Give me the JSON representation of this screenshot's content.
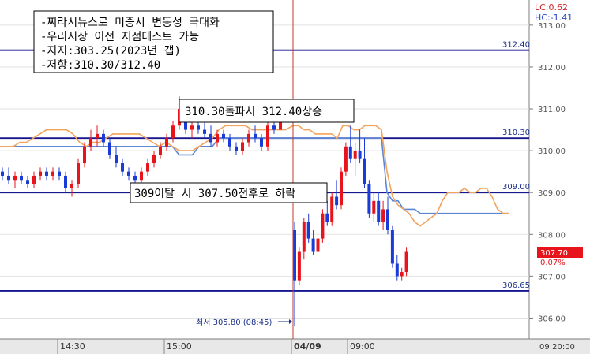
{
  "indicators": {
    "lc": "LC:0.62",
    "hc": "HC:-1.41"
  },
  "notes": [
    "-찌라시뉴스로 미증시 변동성 극대화",
    "-우리시장 이전 저점테스트 가능",
    "-지지:303.25(2023년 갭)",
    "-저항:310.30/312.40"
  ],
  "callouts": {
    "breakout": "310.30돌파시 312.40상승",
    "breakdown": "309이탈 시 307.50전후로 하락"
  },
  "low_label": "최저 305.80 (08:45)",
  "price_tag": {
    "value": "307.70",
    "change": "0.07%"
  },
  "colors": {
    "candle_up": "#e8141b",
    "candle_down": "#1a3bd6",
    "orange_line": "#f2a35c",
    "blue_line": "#5b86d6",
    "hline": "#16168f",
    "session_line": "#c0392b"
  },
  "chart_data": {
    "type": "candlestick",
    "x_labels": [
      "14:30",
      "15:00",
      "04/09",
      "09:00"
    ],
    "time_label": "09:20:00",
    "y_ticks": [
      306.0,
      307.0,
      308.0,
      309.0,
      310.0,
      311.0,
      312.0,
      313.0
    ],
    "y_range": [
      305.5,
      313.6
    ],
    "grid": true,
    "levels": [
      312.4,
      310.3,
      309.0,
      306.65
    ],
    "level_labels": [
      "312.40",
      "310.30",
      "309.00",
      "306.65"
    ],
    "low": 305.8,
    "last": 307.7,
    "candles": [
      [
        309.5,
        309.6,
        309.3,
        309.4
      ],
      [
        309.4,
        309.6,
        309.2,
        309.3
      ],
      [
        309.3,
        309.5,
        309.1,
        309.4
      ],
      [
        309.4,
        309.5,
        309.2,
        309.3
      ],
      [
        309.3,
        309.4,
        309.1,
        309.2
      ],
      [
        309.2,
        309.5,
        309.1,
        309.4
      ],
      [
        309.4,
        309.6,
        309.3,
        309.5
      ],
      [
        309.5,
        309.6,
        309.3,
        309.4
      ],
      [
        309.4,
        309.6,
        309.3,
        309.5
      ],
      [
        309.5,
        309.6,
        309.3,
        309.4
      ],
      [
        309.4,
        309.5,
        309.0,
        309.1
      ],
      [
        309.1,
        309.3,
        308.9,
        309.2
      ],
      [
        309.2,
        309.8,
        309.1,
        309.7
      ],
      [
        309.7,
        310.2,
        309.6,
        310.1
      ],
      [
        310.1,
        310.5,
        310.0,
        310.3
      ],
      [
        310.3,
        310.6,
        310.1,
        310.4
      ],
      [
        310.4,
        310.5,
        310.1,
        310.2
      ],
      [
        310.2,
        310.3,
        309.8,
        309.9
      ],
      [
        309.9,
        310.1,
        309.6,
        309.7
      ],
      [
        309.7,
        309.8,
        309.4,
        309.5
      ],
      [
        309.5,
        309.6,
        309.3,
        309.4
      ],
      [
        309.4,
        309.5,
        309.2,
        309.3
      ],
      [
        309.3,
        309.6,
        309.2,
        309.5
      ],
      [
        309.5,
        309.8,
        309.4,
        309.7
      ],
      [
        309.7,
        310.0,
        309.6,
        309.9
      ],
      [
        309.9,
        310.2,
        309.8,
        310.1
      ],
      [
        310.1,
        310.4,
        310.0,
        310.3
      ],
      [
        310.3,
        310.7,
        310.2,
        310.6
      ],
      [
        310.6,
        311.3,
        310.5,
        311.0
      ],
      [
        311.0,
        311.1,
        310.4,
        310.5
      ],
      [
        310.5,
        310.7,
        310.3,
        310.6
      ],
      [
        310.6,
        310.8,
        310.4,
        310.5
      ],
      [
        310.5,
        310.7,
        310.3,
        310.4
      ],
      [
        310.4,
        310.6,
        310.1,
        310.2
      ],
      [
        310.2,
        310.5,
        310.1,
        310.4
      ],
      [
        310.4,
        310.5,
        310.2,
        310.3
      ],
      [
        310.3,
        310.4,
        310.0,
        310.1
      ],
      [
        310.1,
        310.2,
        309.9,
        310.0
      ],
      [
        310.0,
        310.3,
        309.9,
        310.2
      ],
      [
        310.2,
        310.5,
        310.1,
        310.4
      ],
      [
        310.4,
        310.6,
        310.2,
        310.3
      ],
      [
        310.3,
        310.4,
        310.0,
        310.1
      ],
      [
        310.1,
        310.7,
        310.0,
        310.6
      ],
      [
        310.6,
        310.9,
        310.4,
        310.5
      ],
      [
        310.5,
        311.1,
        310.5,
        311.0
      ],
      [
        308.1,
        308.3,
        305.8,
        306.9
      ],
      [
        306.9,
        307.7,
        306.8,
        307.6
      ],
      [
        307.6,
        308.4,
        307.4,
        308.3
      ],
      [
        308.3,
        308.5,
        307.8,
        307.9
      ],
      [
        307.9,
        308.1,
        307.5,
        307.6
      ],
      [
        307.6,
        308.0,
        307.4,
        307.9
      ],
      [
        307.9,
        308.6,
        307.8,
        308.5
      ],
      [
        308.5,
        308.8,
        308.2,
        308.3
      ],
      [
        308.3,
        309.0,
        308.2,
        308.9
      ],
      [
        308.9,
        309.3,
        308.6,
        308.7
      ],
      [
        308.7,
        309.6,
        308.6,
        309.5
      ],
      [
        309.5,
        310.2,
        309.4,
        310.1
      ],
      [
        310.1,
        310.6,
        309.7,
        309.8
      ],
      [
        309.8,
        310.2,
        309.4,
        310.0
      ],
      [
        310.0,
        310.5,
        309.7,
        309.8
      ],
      [
        309.8,
        310.3,
        309.1,
        309.2
      ],
      [
        309.2,
        309.3,
        308.4,
        308.5
      ],
      [
        308.5,
        309.0,
        308.3,
        308.8
      ],
      [
        308.8,
        309.0,
        308.2,
        308.3
      ],
      [
        308.3,
        308.8,
        308.1,
        308.6
      ],
      [
        308.6,
        308.9,
        308.0,
        308.1
      ],
      [
        308.1,
        308.2,
        307.2,
        307.3
      ],
      [
        307.3,
        307.5,
        306.9,
        307.0
      ],
      [
        307.0,
        307.2,
        306.9,
        307.1
      ],
      [
        307.1,
        307.7,
        307.0,
        307.6
      ]
    ],
    "orange_series": [
      310.1,
      310.1,
      310.1,
      310.2,
      310.2,
      310.3,
      310.4,
      310.5,
      310.5,
      310.5,
      310.5,
      310.4,
      310.2,
      310.1,
      310.2,
      310.2,
      310.3,
      310.4,
      310.4,
      310.4,
      310.4,
      310.4,
      310.3,
      310.2,
      310.1,
      310.2,
      310.1,
      310.0,
      310.0,
      310.0,
      310.1,
      310.2,
      310.3,
      310.5,
      310.6,
      310.6,
      310.6,
      310.6,
      310.5,
      310.5,
      310.5,
      310.5,
      310.5,
      310.5,
      310.6,
      310.6,
      310.5,
      310.5,
      310.4,
      310.4,
      310.4,
      310.4,
      310.3,
      310.6,
      310.6,
      310.5,
      310.5,
      310.6,
      310.6,
      310.6,
      310.5,
      309.5,
      308.9,
      308.7,
      308.6,
      308.5,
      308.3,
      308.2,
      308.3,
      308.4,
      308.5,
      308.8,
      309.0,
      309.0,
      309.0,
      309.1,
      309.0,
      309.0,
      309.1,
      309.1,
      308.9,
      308.6,
      308.5,
      308.5
    ],
    "blue_series": [
      310.1,
      310.1,
      310.1,
      310.1,
      310.1,
      310.1,
      310.1,
      310.1,
      310.1,
      310.1,
      310.1,
      310.1,
      310.1,
      310.1,
      310.1,
      310.1,
      310.1,
      310.1,
      310.1,
      310.1,
      310.1,
      310.1,
      310.1,
      310.1,
      310.1,
      310.1,
      310.1,
      309.9,
      309.9,
      309.9,
      310.1,
      310.1,
      310.1,
      310.3,
      310.3,
      310.3,
      310.3,
      310.3,
      310.3,
      310.3,
      310.3,
      310.3,
      310.3,
      310.3,
      310.3,
      310.3,
      310.3,
      310.3,
      310.3,
      310.3,
      310.3,
      310.3,
      310.3,
      310.3,
      310.3,
      310.3,
      310.3,
      310.3,
      310.3,
      310.3,
      310.3,
      309.0,
      308.8,
      308.8,
      308.6,
      308.6,
      308.6,
      308.5,
      308.5,
      308.5,
      308.5,
      308.5,
      308.5,
      308.5,
      308.5,
      308.5,
      308.5,
      308.5,
      308.5,
      308.5,
      308.5,
      308.5,
      308.5,
      308.5
    ]
  }
}
